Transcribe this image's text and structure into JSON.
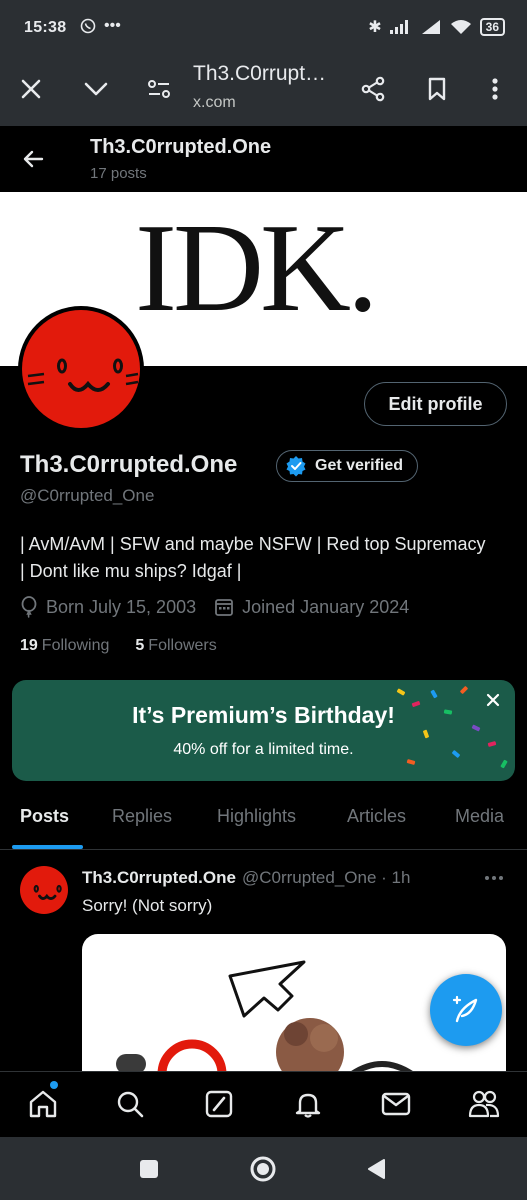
{
  "status": {
    "time": "15:38",
    "battery": "36"
  },
  "browser": {
    "page_title": "Th3.C0rrupt…",
    "domain": "x.com",
    "icons": [
      "close-icon",
      "chevron-down-icon",
      "page-info-icon",
      "share-icon",
      "bookmark-icon",
      "more-vertical-icon"
    ]
  },
  "profile": {
    "top_name": "Th3.C0rrupted.One",
    "post_count": "17 posts",
    "banner_text": "IDK.",
    "edit_button": "Edit profile",
    "display_name": "Th3.C0rrupted.One",
    "get_verified": "Get verified",
    "handle": "@C0rrupted_One",
    "bio_line1": "| AvM/AvM | SFW and maybe NSFW | Red top Supremacy",
    "bio_line2": "| Dont like mu ships? Idgaf |",
    "born": "Born July 15, 2003",
    "joined": "Joined January 2024",
    "following_count": "19",
    "following_label": "Following",
    "followers_count": "5",
    "followers_label": "Followers"
  },
  "promo": {
    "title": "It’s Premium’s Birthday!",
    "subtitle": "40% off for a limited time."
  },
  "tabs": [
    {
      "label": "Posts",
      "active": true
    },
    {
      "label": "Replies",
      "active": false
    },
    {
      "label": "Highlights",
      "active": false
    },
    {
      "label": "Articles",
      "active": false
    },
    {
      "label": "Media",
      "active": false
    }
  ],
  "post": {
    "author": "Th3.C0rrupted.One",
    "handle_time": "@C0rrupted_One · 1h",
    "text": "Sorry! (Not sorry)"
  },
  "colors": {
    "accent": "#1d9bf0",
    "avatar_red": "#e21a0c",
    "promo_bg": "#1b5b49"
  }
}
